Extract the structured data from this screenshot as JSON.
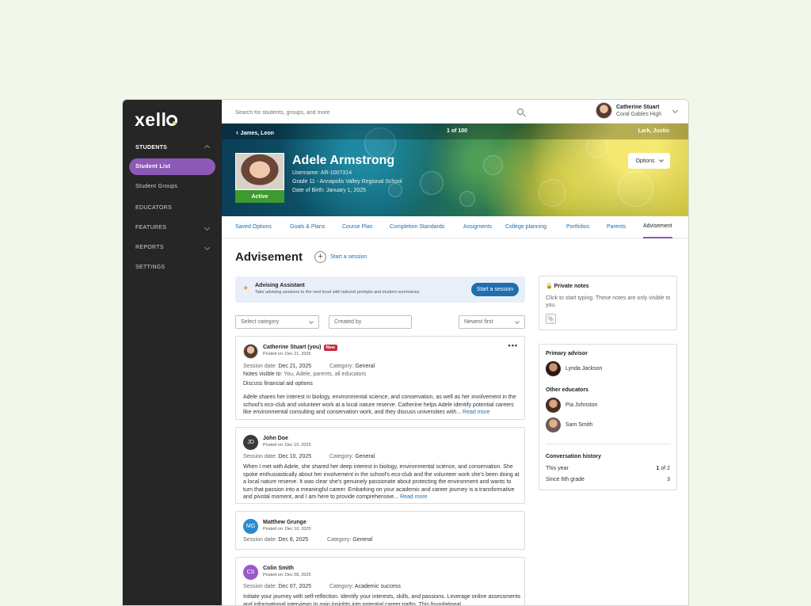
{
  "sidebar": {
    "logo": "xello",
    "items": [
      {
        "label": "STUDENTS"
      },
      {
        "label": "Student List"
      },
      {
        "label": "Student Groups"
      },
      {
        "label": "EDUCATORS"
      },
      {
        "label": "FEATURES"
      },
      {
        "label": "REPORTS"
      },
      {
        "label": "SETTINGS"
      }
    ]
  },
  "topbar": {
    "search_placeholder": "Search for students, groups, and more",
    "user_name": "Catherine Stuart",
    "user_school": "Coral Gables High"
  },
  "banner": {
    "prev_student": "James, Leon",
    "position": "1 of 100",
    "next_student": "Lark, Justin",
    "name": "Adele Armstrong",
    "username": "Username: AR-1007314",
    "grade": "Grade 11 - Annapolis Valley Regional School",
    "dob": "Date of Birth: January 1, 2025",
    "status": "Active",
    "options_label": "Options"
  },
  "tabs": [
    {
      "label": "Saved Options"
    },
    {
      "label": "Goals & Plans"
    },
    {
      "label": "Course Plan"
    },
    {
      "label": "Completion Standards"
    },
    {
      "label": "Assigments"
    },
    {
      "label": "College planning"
    },
    {
      "label": "Portfolios"
    },
    {
      "label": "Parents"
    },
    {
      "label": "Advisement"
    }
  ],
  "main": {
    "title": "Advisement",
    "start_session": "Start a session",
    "assistant": {
      "title": "Advising Assistant",
      "desc": "Take advising sessions to the next level with tailored prompts and student summaries.",
      "button": "Start a session"
    },
    "filters": {
      "category": "Select category",
      "created_by": "Created by",
      "sort": "Newest first"
    },
    "notes": [
      {
        "initials": "",
        "name": "Catherine Stuart (you)",
        "badge": "New",
        "posted": "Posted on: Dec 21, 2025",
        "session_label": "Session date:",
        "session_date": "Dec 21, 2025",
        "category_label": "Category:",
        "category": "General",
        "visible_label": "Notes visible to:",
        "visible_to": "You, Adele, parents, all educators",
        "subject": "Discuss financial aid options",
        "body": "Adele shares her interest in biology, environmental science, and conservation, as well as her involvement in the school's eco-club and volunteer work at a local nature reserve. Catherine helps Adele identify potential careers like environmental consulting and conservation work, and they discuss universities with...",
        "read_more": "Read more"
      },
      {
        "initials": "JD",
        "name": "John Doe",
        "posted": "Posted on: Dec 10, 2025",
        "session_label": "Session date:",
        "session_date": "Dec 10, 2025",
        "category_label": "Category:",
        "category": "General",
        "body": "When I met with Adele, she shared her deep interest in biology, environmental science, and conservation. She spoke enthusiastically about her involvement in the school's eco-club and the volunteer work she's been doing at a local nature reserve. It was clear she's genuinely passionate about protecting the environment and wants to turn that passion into a meaningful career. Embarking on your academic and career journey is a transformative and pivotal moment, and I am here to provide comprehensive...",
        "read_more": "Read more",
        "color": "#3a3a3a"
      },
      {
        "initials": "MG",
        "name": "Matthew Grunge",
        "posted": "Posted on: Dec 10, 2025",
        "session_label": "Session date:",
        "session_date": "Dec 8, 2025",
        "category_label": "Category:",
        "category": "General",
        "color": "#2a8bd0"
      },
      {
        "initials": "CS",
        "name": "Colin Smith",
        "posted": "Posted on: Dec 08, 2025",
        "session_label": "Session date:",
        "session_date": "Dec 07, 2025",
        "category_label": "Category:",
        "category": "Academic success",
        "body": "Initiate your journey with self-reflection. Identify your interests, skills, and passions. Leverage online assessments and informational interviews to gain insights into potential career paths. This foundational",
        "color": "#9b59c9"
      }
    ]
  },
  "right": {
    "private_notes": {
      "title": "Private notes",
      "text": "Click to start typing. These notes are only visible to you."
    },
    "advisors": {
      "primary_title": "Primary advisor",
      "primary": "Lynda Jackson",
      "others_title": "Other educators",
      "others": [
        "Pia Johnston",
        "Sam Smith"
      ]
    },
    "history": {
      "title": "Conversation history",
      "rows": [
        {
          "label": "This year",
          "value": "1",
          "suffix": "of 2"
        },
        {
          "label": "Since 6th grade",
          "value": "3"
        }
      ]
    }
  }
}
